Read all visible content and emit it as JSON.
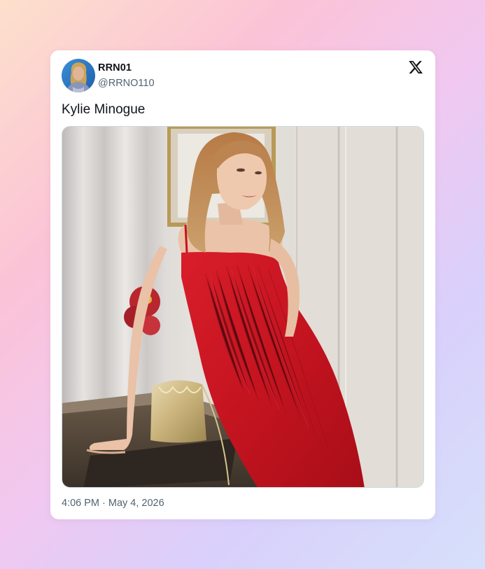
{
  "tweet": {
    "display_name": "RRN01",
    "handle": "@RRNO110",
    "text": "Kylie Minogue",
    "timestamp": "4:06 PM · May 4, 2026",
    "platform_icon": "x-logo-icon",
    "avatar_icon": "avatar"
  },
  "colors": {
    "primary_text": "#0f1419",
    "secondary_text": "#536471",
    "card_background": "#ffffff",
    "dress": "#c41420"
  }
}
